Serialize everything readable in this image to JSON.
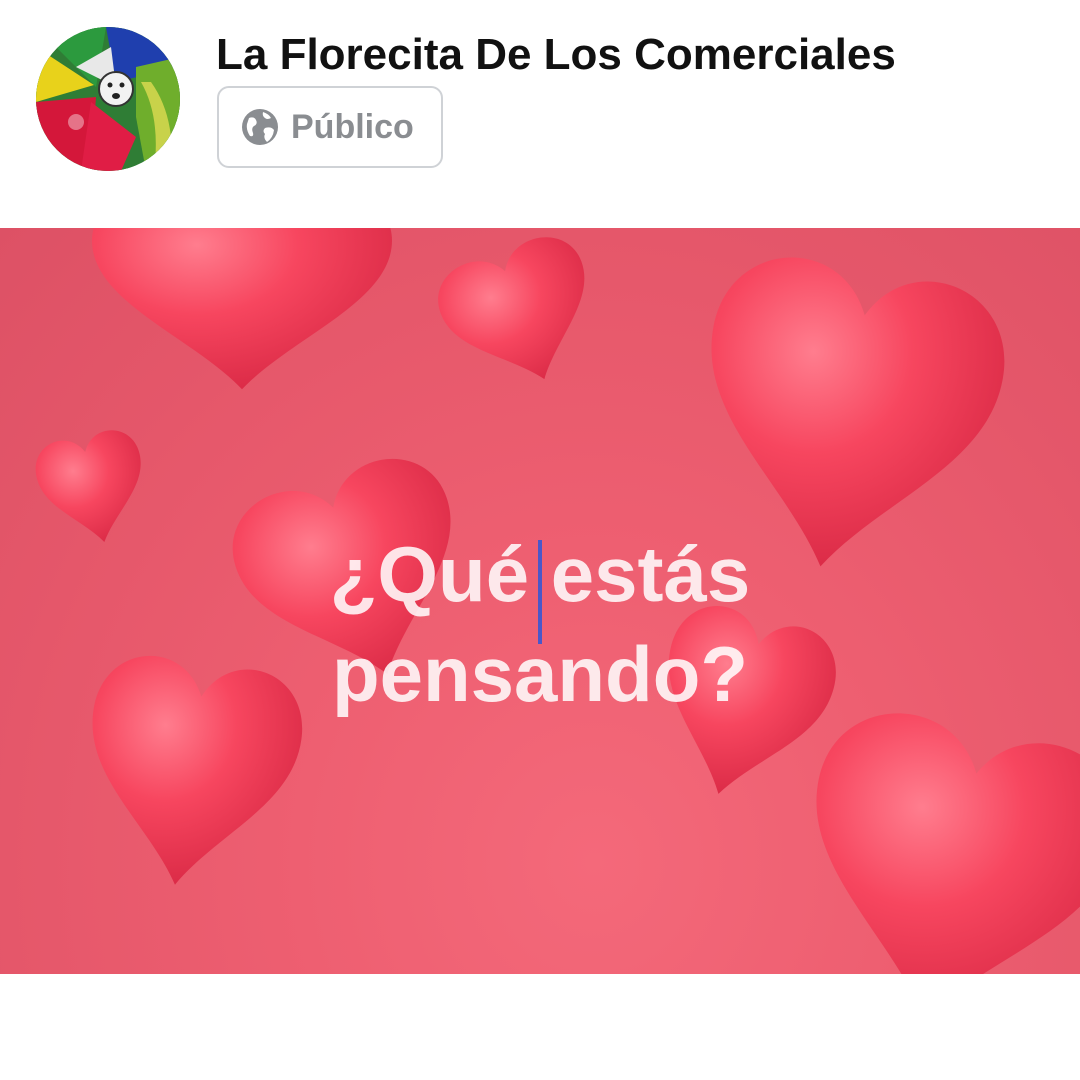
{
  "header": {
    "page_name": "La Florecita De Los Comerciales",
    "avatar_icon": "flower-clown-avatar",
    "audience": {
      "label": "Público",
      "icon": "globe-icon"
    }
  },
  "composer": {
    "placeholder_line1": "¿Qué estás",
    "placeholder_line2": "pensando?",
    "background_theme": "red-hearts",
    "colors": {
      "background": "#ee5f71",
      "heart": "#f23a55",
      "caret": "#4a57c9",
      "text": "#ffffff"
    }
  }
}
